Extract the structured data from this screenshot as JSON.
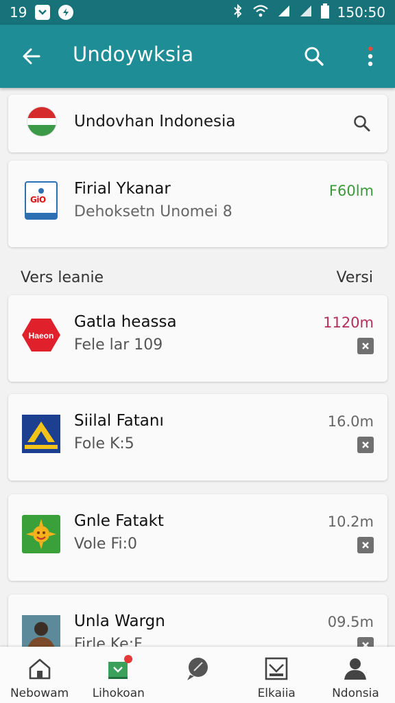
{
  "status_bar": {
    "left_text": "19",
    "time": "150:50",
    "icons": [
      "notification-box-icon",
      "lightning-icon",
      "bluetooth-icon",
      "wifi-icon",
      "signal-icon",
      "signal-icon",
      "battery-icon"
    ]
  },
  "app_bar": {
    "title": "Undoywksia",
    "icons": [
      "back-arrow-icon",
      "search-icon",
      "more-vert-icon"
    ],
    "accent": "#1f8d95"
  },
  "header_card": {
    "name": "Undovhan Indonesia",
    "icon": "flag-icon"
  },
  "featured": {
    "title": "Firial Ykanar",
    "subtitle": "Dehoksetn Unomei 8",
    "size": "F60lm",
    "size_color": "#3a9a37"
  },
  "section": {
    "left": "Vers leanie",
    "right": "Versi"
  },
  "items": [
    {
      "title": "Gatla heassa",
      "subtitle": "Fele lar 109",
      "size": "1120m",
      "icon_text": "Haeon",
      "icon": "red-hexagon-icon"
    },
    {
      "title": "Siilal Fatanı",
      "subtitle": "Fole K:5",
      "size": "16.0m",
      "icon": "blue-building-icon"
    },
    {
      "title": "Gnle Fatakt",
      "subtitle": "Vole Fi:0",
      "size": "10.2m",
      "icon": "green-sun-icon"
    },
    {
      "title": "Unla Wargn",
      "subtitle": "Firle Ke:F",
      "size": "09.5m",
      "icon": "person-photo-icon"
    }
  ],
  "bottom_nav": [
    {
      "label": "Nebowam",
      "icon": "home-icon"
    },
    {
      "label": "Lihokoan",
      "icon": "download-box-icon"
    },
    {
      "label": "",
      "icon": "chat-bubble-icon"
    },
    {
      "label": "Elkaiia",
      "icon": "image-frame-icon"
    },
    {
      "label": "Ndonsia",
      "icon": "person-icon"
    }
  ]
}
